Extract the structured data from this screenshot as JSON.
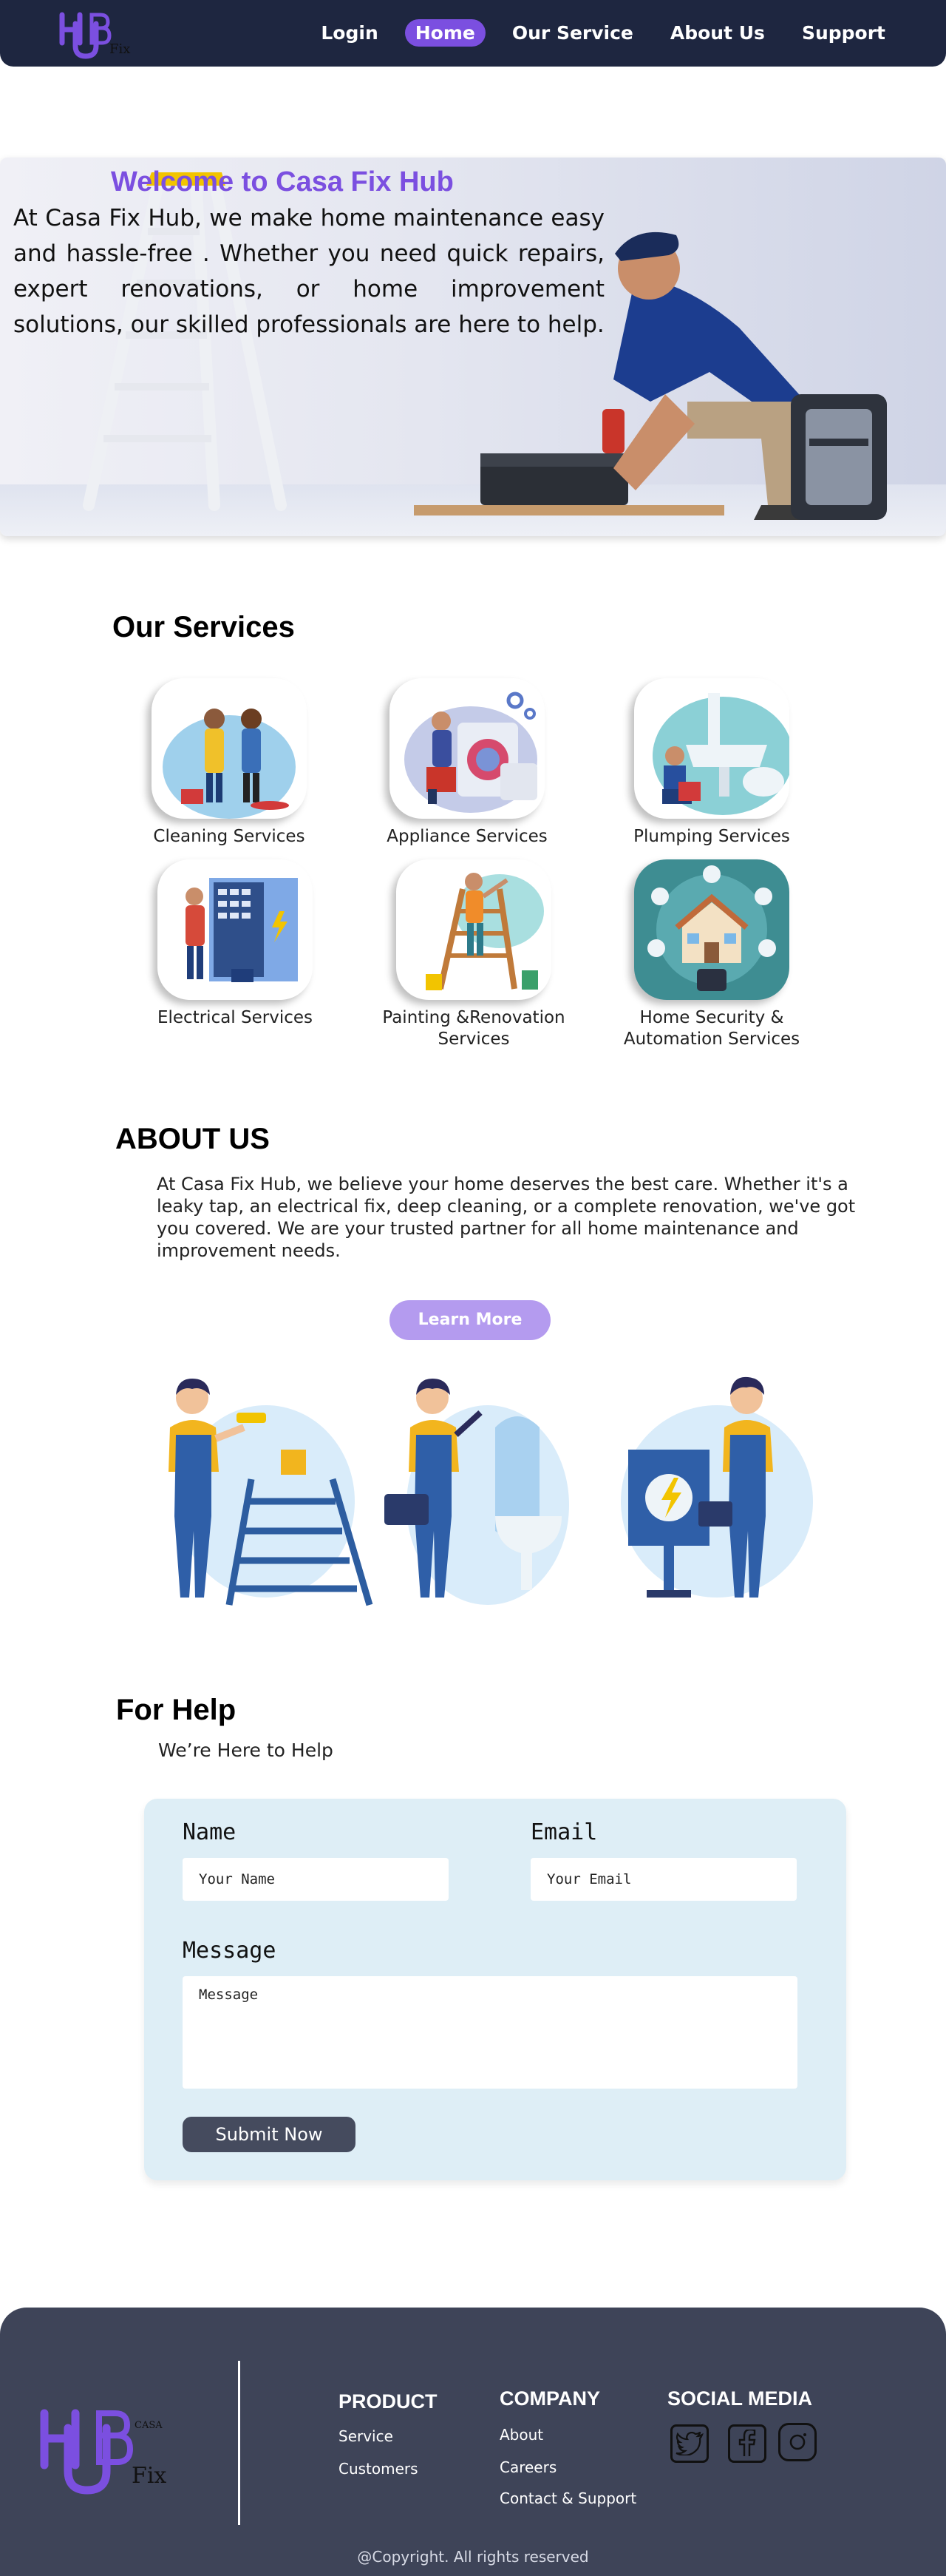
{
  "logo": {
    "main": "HUB",
    "sub": "Fix",
    "vertical": "CASA"
  },
  "nav": {
    "items": [
      {
        "label": "Login"
      },
      {
        "label": "Home"
      },
      {
        "label": "Our Service"
      },
      {
        "label": "About Us"
      },
      {
        "label": "Support"
      }
    ],
    "active": "Home"
  },
  "hero": {
    "title": "Welcome to Casa Fix Hub",
    "text": "At Casa Fix Hub, we make home maintenance easy and hassle-free . Whether you need quick repairs, expert renovations, or home improvement solutions, our skilled professionals are here to help."
  },
  "services": {
    "title": "Our Services",
    "items": [
      {
        "label": "Cleaning Services",
        "icon": "cleaning-icon"
      },
      {
        "label": "Appliance Services",
        "icon": "appliance-icon"
      },
      {
        "label": "Plumping Services",
        "icon": "plumbing-icon"
      },
      {
        "label": "Electrical Services",
        "icon": "electrical-icon"
      },
      {
        "label": "Painting &Renovation Services",
        "icon": "painting-icon"
      },
      {
        "label": "Home Security & Automation Services",
        "icon": "smart-home-icon"
      }
    ]
  },
  "about": {
    "title": "ABOUT US",
    "text": "At Casa Fix Hub, we believe your home deserves the best care. Whether it's a leaky tap, an electrical fix, deep cleaning, or a complete renovation, we've got you covered. We are your trusted partner for all home maintenance and improvement needs.",
    "button": "Learn More"
  },
  "help": {
    "title": "For Help",
    "subtitle": "We’re Here to Help",
    "form": {
      "name_label": "Name",
      "name_placeholder": "Your Name",
      "email_label": "Email",
      "email_placeholder": "Your Email",
      "message_label": "Message",
      "message_placeholder": "Message",
      "submit": "Submit Now"
    }
  },
  "footer": {
    "product": {
      "title": "PRODUCT",
      "items": [
        "Service",
        "Customers"
      ]
    },
    "company": {
      "title": "COMPANY",
      "items": [
        "About",
        "Careers",
        "Contact & Support"
      ]
    },
    "social": {
      "title": "SOCIAL MEDIA",
      "icons": [
        "twitter-icon",
        "facebook-icon",
        "instagram-icon"
      ]
    },
    "copyright": "@Copyright. All rights reserved"
  },
  "colors": {
    "nav_bg": "#1e2640",
    "accent": "#7b4fe0",
    "footer_bg": "#3e4458",
    "form_bg": "#deeef6",
    "button_light": "#b49bef"
  }
}
